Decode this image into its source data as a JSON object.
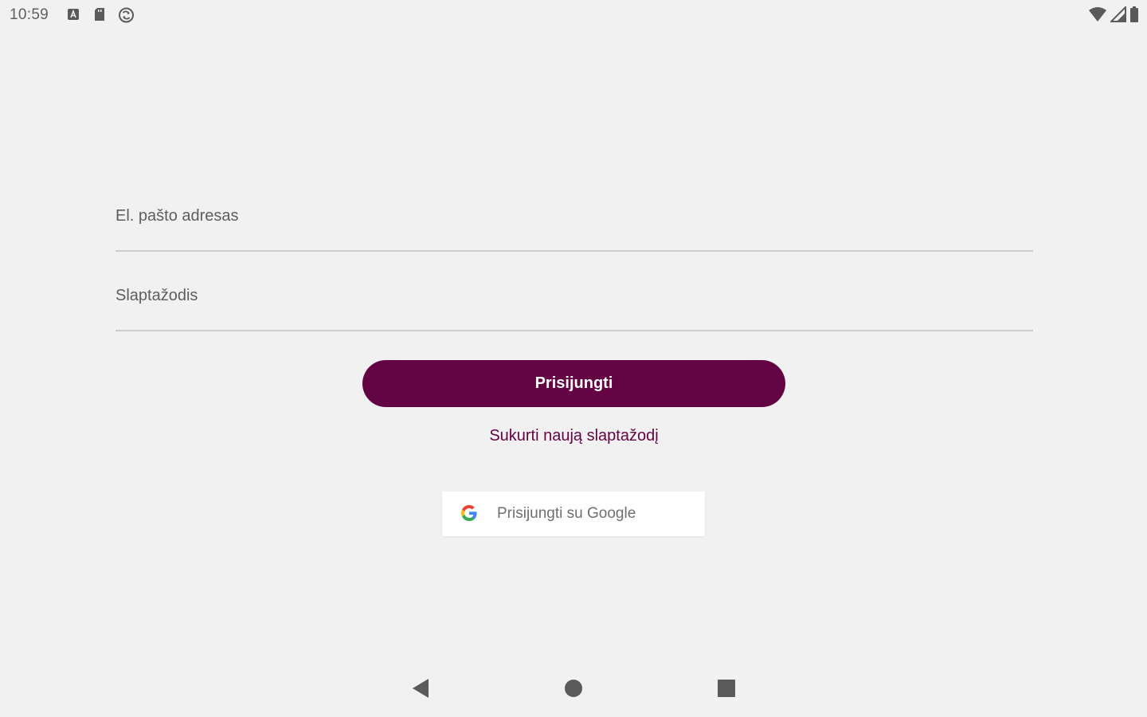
{
  "status_bar": {
    "time": "10:59",
    "icons": [
      "notification-a-icon",
      "sd-card-icon",
      "sync-icon",
      "wifi-icon",
      "cell-signal-icon",
      "battery-icon"
    ]
  },
  "login_form": {
    "email_placeholder": "El. pašto adresas",
    "email_value": "",
    "password_placeholder": "Slaptažodis",
    "password_value": "",
    "login_label": "Prisijungti",
    "reset_password_label": "Sukurti naują slaptažodį",
    "google_login_label": "Prisijungti su Google"
  },
  "nav_bar": {
    "icons": [
      "back-icon",
      "home-icon",
      "recents-icon"
    ]
  },
  "colors": {
    "accent": "#640343",
    "background": "#f1f1f1",
    "divider": "#cdcdcd"
  }
}
